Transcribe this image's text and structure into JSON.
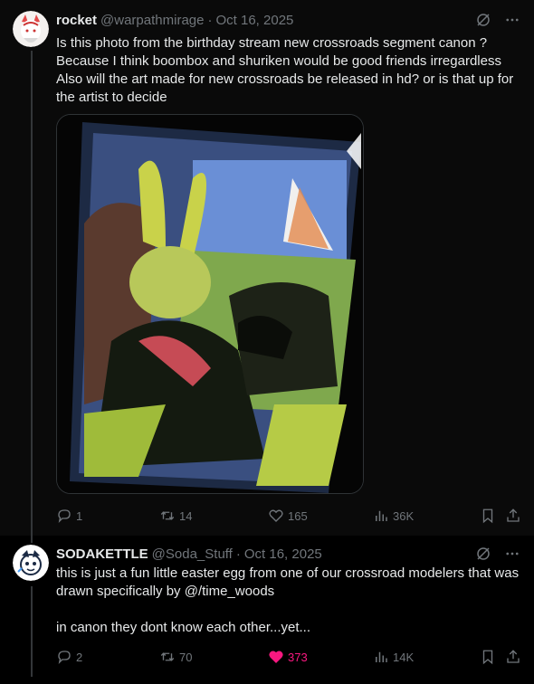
{
  "posts": [
    {
      "name": "rocket",
      "handle": "@warpathmirage",
      "separator": "·",
      "date": "Oct 16, 2025",
      "text": "Is this photo from the birthday stream new crossroads segment canon ?\nBecause I think boombox and shuriken would be good friends irregardless\nAlso will the art made for new crossroads be released in hd? or is that up for the artist to decide",
      "stats": {
        "replies": "1",
        "reposts": "14",
        "likes": "165",
        "views": "36K"
      },
      "liked": false,
      "icons": [
        "grok-icon",
        "more-icon",
        "reply-icon",
        "repost-icon",
        "like-icon",
        "views-icon",
        "bookmark-icon",
        "share-icon"
      ]
    },
    {
      "name": "SODAKETTLE",
      "handle": "@Soda_Stuff",
      "separator": "·",
      "date": "Oct 16, 2025",
      "text": "this is just a fun little easter egg from one of our crossroad modelers that was drawn specifically by @/time_woods\n\nin canon they dont know each other...yet...",
      "stats": {
        "replies": "2",
        "reposts": "70",
        "likes": "373",
        "views": "14K"
      },
      "liked": true
    }
  ],
  "colors": {
    "background": "#000000",
    "text": "#e7e9ea",
    "muted": "#71767b",
    "like": "#f91880",
    "border": "#2f3336"
  }
}
